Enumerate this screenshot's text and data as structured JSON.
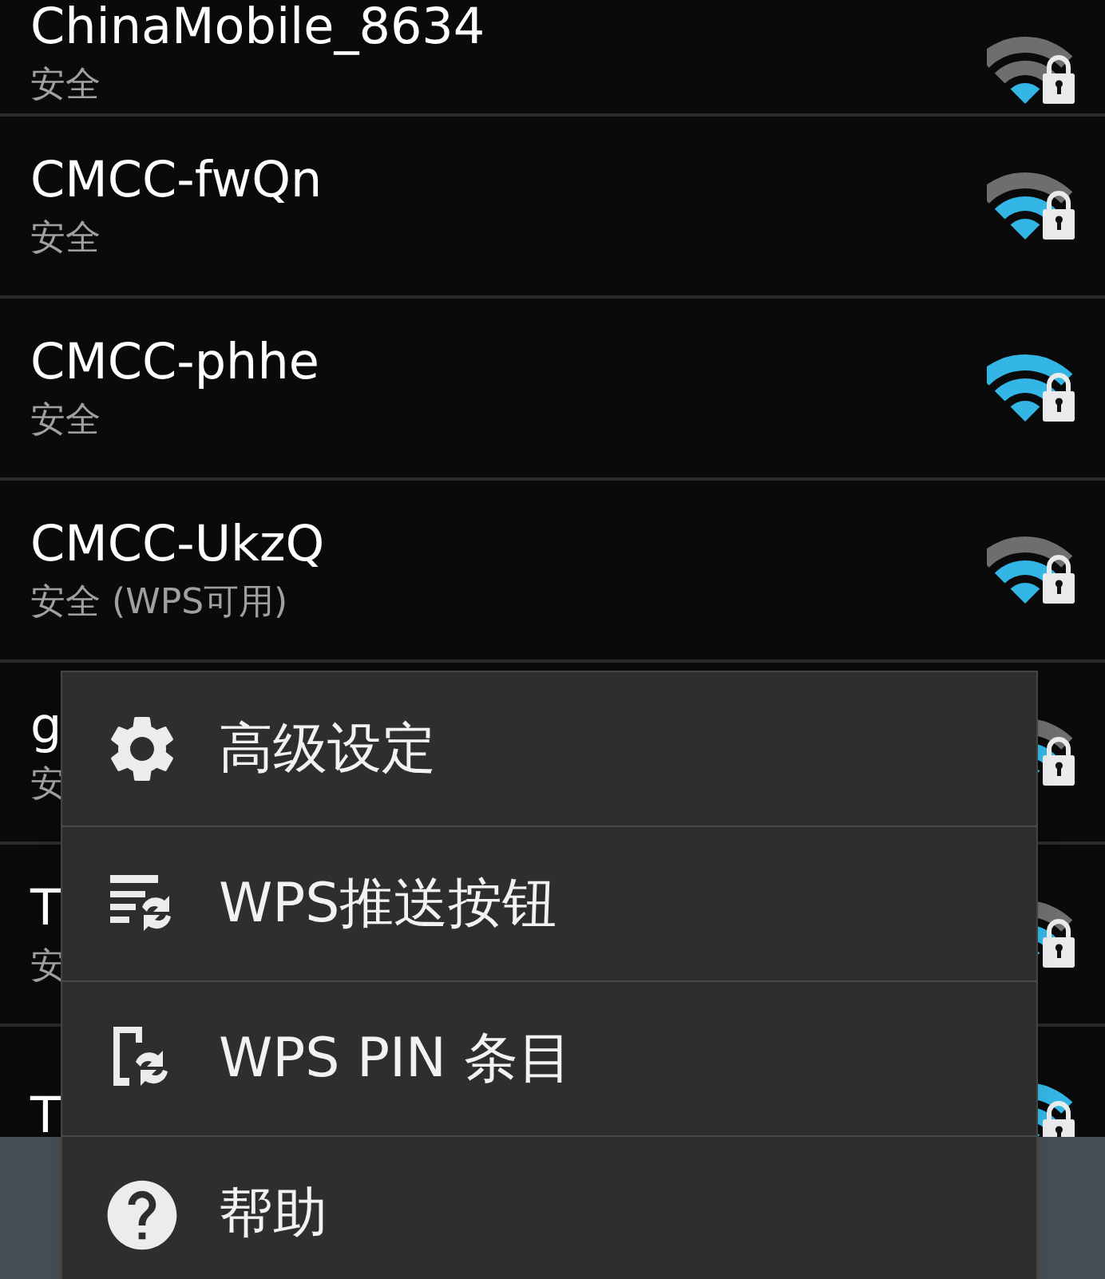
{
  "networks": [
    {
      "name": "ChinaMobile_8634",
      "security": "安全",
      "kind": "weak"
    },
    {
      "name": "CMCC-fwQn",
      "security": "安全",
      "kind": "medium"
    },
    {
      "name": "CMCC-phhe",
      "security": "安全",
      "kind": "full"
    },
    {
      "name": "CMCC-UkzQ",
      "security": "安全 (WPS可用)",
      "kind": "medium"
    },
    {
      "name": "g",
      "security": "安",
      "kind": "medium"
    },
    {
      "name": "T",
      "security": "安",
      "kind": "medium"
    },
    {
      "name": "T",
      "kind": "full"
    }
  ],
  "menu": {
    "items": [
      {
        "label": "高级设定",
        "kind": "settings"
      },
      {
        "label": "WPS推送按钮",
        "kind": "wps-push"
      },
      {
        "label": "WPS PIN 条目",
        "kind": "wps-pin"
      },
      {
        "label": "帮助",
        "kind": "help"
      }
    ]
  }
}
